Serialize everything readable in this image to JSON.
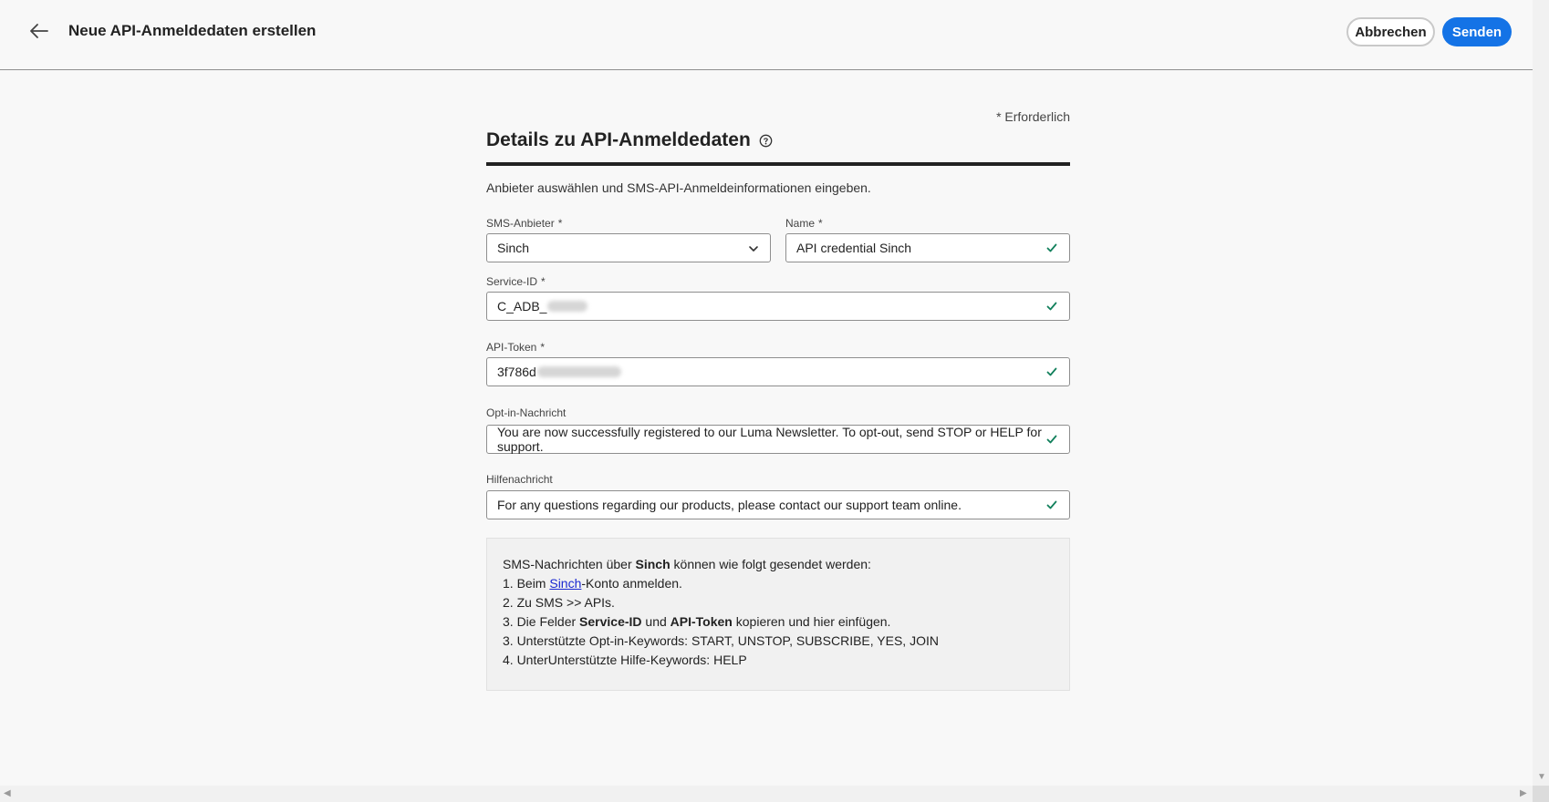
{
  "header": {
    "title": "Neue API-Anmeldedaten erstellen",
    "cancel_label": "Abbrechen",
    "send_label": "Senden"
  },
  "form": {
    "required_note": "* Erforderlich",
    "section_title": "Details zu API-Anmeldedaten",
    "description": "Anbieter auswählen und SMS-API-Anmeldeinformationen eingeben.",
    "required_marker": "*",
    "provider": {
      "label": "SMS-Anbieter",
      "value": "Sinch"
    },
    "name": {
      "label": "Name",
      "value": "API credential Sinch"
    },
    "service_id": {
      "label": "Service-ID",
      "value": "C_ADB_"
    },
    "api_token": {
      "label": "API-Token",
      "value": "3f786d"
    },
    "opt_in": {
      "label": "Opt-in-Nachricht",
      "value": "You are now successfully registered to our Luma Newsletter. To opt-out, send STOP or HELP for support."
    },
    "help": {
      "label": "Hilfenachricht",
      "value": "For any questions regarding our products, please contact our support team online."
    }
  },
  "info": {
    "intro_prefix": "SMS-Nachrichten über ",
    "intro_provider": "Sinch",
    "intro_suffix": " können wie folgt gesendet werden:",
    "step1_prefix": "1. Beim ",
    "step1_link": "Sinch",
    "step1_suffix": "-Konto anmelden.",
    "step2": "2. Zu SMS >> APIs.",
    "step3_prefix": "3. Die Felder ",
    "step3_bold1": "Service-ID",
    "step3_mid": " und ",
    "step3_bold2": "API-Token",
    "step3_suffix": " kopieren und hier einfügen.",
    "step4": "3. Unterstützte Opt-in-Keywords: START, UNSTOP, SUBSCRIBE, YES, JOIN",
    "step5": "4. UnterUnterstützte Hilfe-Keywords: HELP"
  },
  "colors": {
    "accent": "#1473e6",
    "valid": "#12805c",
    "link": "#1a28d1"
  },
  "icons": [
    "back-arrow-icon",
    "help-circle-icon",
    "chevron-down-icon",
    "checkmark-icon"
  ]
}
